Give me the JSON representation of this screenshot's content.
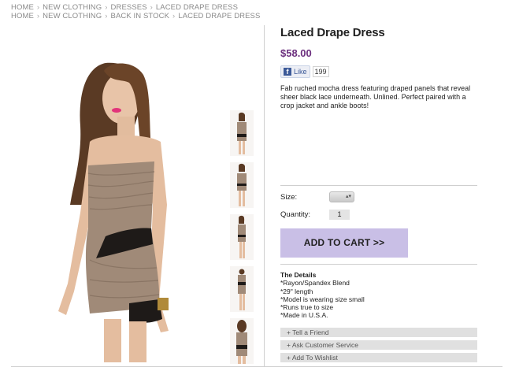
{
  "breadcrumbs": [
    [
      "HOME",
      "NEW CLOTHING",
      "DRESSES",
      "LACED DRAPE DRESS"
    ],
    [
      "HOME",
      "NEW CLOTHING",
      "BACK IN STOCK",
      "LACED DRAPE DRESS"
    ]
  ],
  "product": {
    "title": "Laced Drape Dress",
    "price": "$58.00",
    "like_label": "Like",
    "like_count": "199",
    "description": "Fab ruched mocha dress featuring draped panels that reveal sheer black lace underneath. Unlined. Perfect paired with a crop jacket and ankle boots!"
  },
  "purchase": {
    "size_label": "Size:",
    "quantity_label": "Quantity:",
    "quantity_value": "1",
    "add_to_cart": "ADD TO CART >>"
  },
  "details": {
    "heading": "The Details",
    "items": [
      "*Rayon/Spandex Blend",
      "*29\" length",
      "*Model is wearing size small",
      "*Runs true to size",
      "*Made in U.S.A."
    ]
  },
  "actions": [
    "+ Tell a Friend",
    "+ Ask Customer Service",
    "+ Add To Wishlist"
  ],
  "colors": {
    "price": "#6b2f7e",
    "cart_button": "#c9bfe6",
    "dress": "#a08a78",
    "lace": "#1e1a18"
  },
  "images": {
    "hero": "model-in-dress",
    "thumbs": [
      "front-view",
      "full-front",
      "full-side",
      "back-view",
      "back-detail"
    ]
  }
}
